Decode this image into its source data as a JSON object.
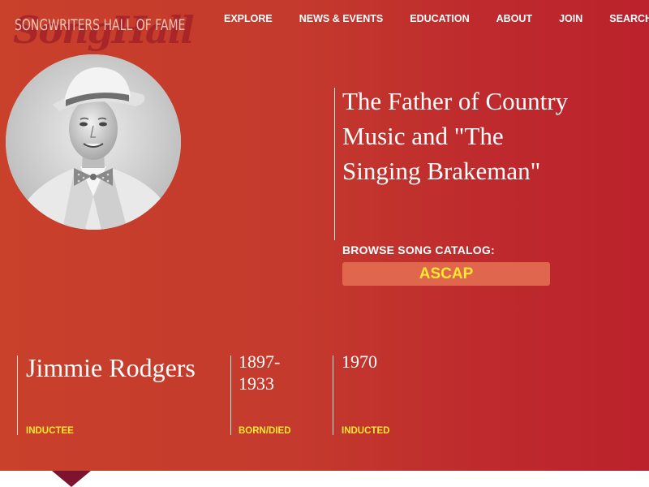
{
  "site": {
    "logo_text": "SONGWRITERS HALL OF FAME",
    "logo_script": "SongHall"
  },
  "nav": {
    "items": [
      "EXPLORE",
      "NEWS & EVENTS",
      "EDUCATION",
      "ABOUT",
      "JOIN"
    ],
    "search_label": "SEARCH"
  },
  "hero": {
    "tagline": "The Father of Country Music and \"The Singing Brakeman\"",
    "browse_label": "BROWSE SONG CATALOG:",
    "catalog_button": "ASCAP"
  },
  "inductee": {
    "name": "Jimmie Rodgers",
    "name_caption": "INDUCTEE",
    "born_died": "1897-1933",
    "born_died_caption": "BORN/DIED",
    "inducted_year": "1970",
    "inducted_caption": "INDUCTED"
  },
  "colors": {
    "hero_gradient_start": "#c9402b",
    "hero_gradient_end": "#bb222c",
    "accent_yellow": "#ffe82e",
    "button_bg": "#e1664e",
    "pointer": "#7e1330"
  },
  "icons": {
    "search": "search-icon",
    "photo": "portrait-photo"
  }
}
